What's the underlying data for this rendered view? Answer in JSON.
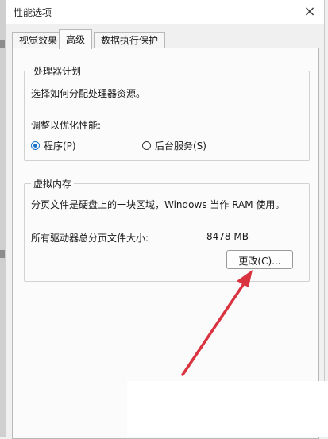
{
  "window": {
    "title": "性能选项"
  },
  "tabs": [
    {
      "label": "视觉效果",
      "active": false
    },
    {
      "label": "高级",
      "active": true
    },
    {
      "label": "数据执行保护",
      "active": false
    }
  ],
  "processor": {
    "title": "处理器计划",
    "desc": "选择如何分配处理器资源。",
    "adjust_label": "调整以优化性能:",
    "options": [
      {
        "label": "程序(P)",
        "checked": true
      },
      {
        "label": "后台服务(S)",
        "checked": false
      }
    ]
  },
  "virtual_memory": {
    "title": "虚拟内存",
    "desc": "分页文件是硬盘上的一块区域，Windows 当作 RAM 使用。",
    "total_label": "所有驱动器总分页文件大小:",
    "total_value": "8478 MB",
    "change_button": "更改(C)..."
  },
  "colors": {
    "accent": "#1a73c9",
    "annotation_arrow": "#d9333f"
  }
}
